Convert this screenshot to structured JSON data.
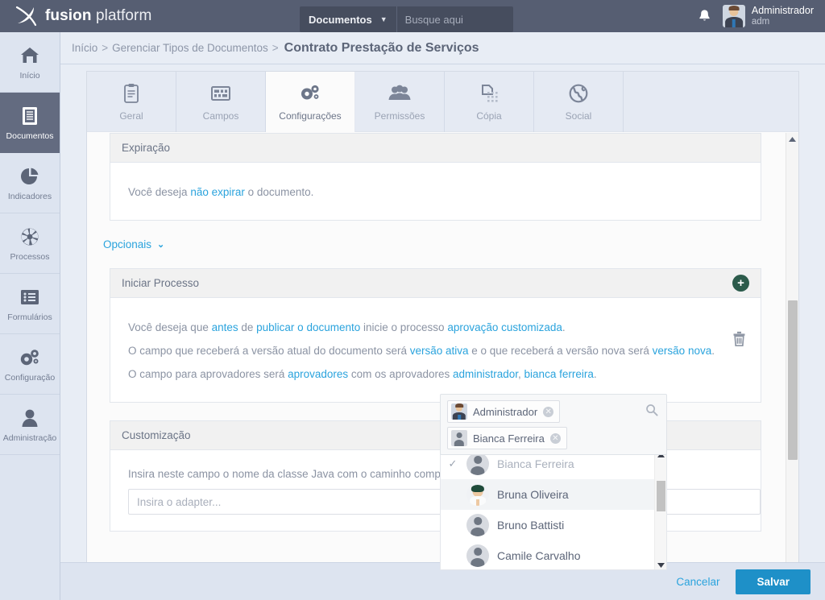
{
  "brand": {
    "name_bold": "fusion",
    "name_light": " platform",
    "logo_icon": "fusion-logo-icon"
  },
  "search": {
    "scope_label": "Documentos",
    "scope_caret": "▼",
    "placeholder": "Busque aqui",
    "value": "",
    "icon": "search-icon"
  },
  "topbar": {
    "notifications_icon": "bell-icon",
    "user_name": "Administrador",
    "user_login": "adm",
    "avatar": "user-avatar"
  },
  "sidebar": {
    "items": [
      {
        "label": "Início",
        "icon": "home-icon",
        "active": false
      },
      {
        "label": "Documentos",
        "icon": "document-icon",
        "active": true
      },
      {
        "label": "Indicadores",
        "icon": "pie-chart-icon",
        "active": false
      },
      {
        "label": "Processos",
        "icon": "aperture-icon",
        "active": false
      },
      {
        "label": "Formulários",
        "icon": "form-list-icon",
        "active": false
      },
      {
        "label": "Configuração",
        "icon": "gears-icon",
        "active": false
      },
      {
        "label": "Administração",
        "icon": "person-icon",
        "active": false
      }
    ]
  },
  "breadcrumb": {
    "root": "Início",
    "separator": ">",
    "parent": "Gerenciar Tipos de Documentos",
    "current": "Contrato Prestação de Serviços"
  },
  "tabs": [
    {
      "label": "Geral",
      "icon": "clipboard-icon",
      "active": false
    },
    {
      "label": "Campos",
      "icon": "grid-fields-icon",
      "active": false
    },
    {
      "label": "Configurações",
      "icon": "gears-icon",
      "active": true
    },
    {
      "label": "Permissões",
      "icon": "users-icon",
      "active": false
    },
    {
      "label": "Cópia",
      "icon": "copy-icon",
      "active": false
    },
    {
      "label": "Social",
      "icon": "globe-icon",
      "active": false
    }
  ],
  "expiracao": {
    "title": "Expiração",
    "sentence_pre": "Você deseja ",
    "link_1": "não expirar",
    "sentence_post": " o documento."
  },
  "opcionais": {
    "label": "Opcionais",
    "caret": "❯"
  },
  "iniciar_processo": {
    "title": "Iniciar Processo",
    "add_icon": "plus-circle-icon",
    "delete_icon": "trash-icon",
    "line1": {
      "p1": "Você deseja que ",
      "l1": "antes",
      "p2": " de ",
      "l2": "publicar o documento",
      "p3": " inicie o processo ",
      "l3": "aprovação customizada",
      "p4": "."
    },
    "line2": {
      "p1": "O campo que receberá a versão atual do documento será ",
      "l1": "versão ativa",
      "p2": " e o que receberá a versão nova será ",
      "l2": "versão nova",
      "p3": "."
    },
    "line3": {
      "p1": "O campo para aprovadores será ",
      "l1": "aprovadores",
      "p2": " com os aprovadores ",
      "l2": "administrador",
      "p3": ", ",
      "l3": "bianca ferreira",
      "p4": "."
    }
  },
  "approver_picker": {
    "search_icon": "search-icon",
    "selected": [
      {
        "name": "Administrador",
        "avatar": "avatar-administrador",
        "remove_icon": "remove-icon"
      },
      {
        "name": "Bianca Ferreira",
        "avatar": "avatar-generic",
        "remove_icon": "remove-icon"
      }
    ],
    "options": [
      {
        "name": "Bianca Ferreira",
        "selected": true,
        "hovered": false,
        "check": "✓",
        "avatar": "avatar-generic"
      },
      {
        "name": "Bruna Oliveira",
        "selected": false,
        "hovered": true,
        "check": "",
        "avatar": "avatar-bruna"
      },
      {
        "name": "Bruno Battisti",
        "selected": false,
        "hovered": false,
        "check": "",
        "avatar": "avatar-generic"
      },
      {
        "name": "Camile Carvalho",
        "selected": false,
        "hovered": false,
        "check": "",
        "avatar": "avatar-generic"
      }
    ],
    "scroll_up_icon": "triangle-up-icon",
    "scroll_down_icon": "triangle-down-icon"
  },
  "customizacao": {
    "title": "Customização",
    "hint": "Insira neste campo o nome da classe Java com o caminho completo do adapter.",
    "input_placeholder": "Insira o adapter...",
    "input_value": ""
  },
  "panel_scroll": {
    "up_icon": "triangle-up-icon",
    "down_icon": "triangle-down-icon"
  },
  "footer": {
    "cancel_label": "Cancelar",
    "save_label": "Salvar"
  },
  "colors": {
    "topbar_bg": "#565e72",
    "sidebar_bg": "#dde4f0",
    "accent_link": "#2aa3dd",
    "save_button": "#1e90c8",
    "add_button": "#2c5b4b",
    "page_bg": "#e8edf5"
  }
}
